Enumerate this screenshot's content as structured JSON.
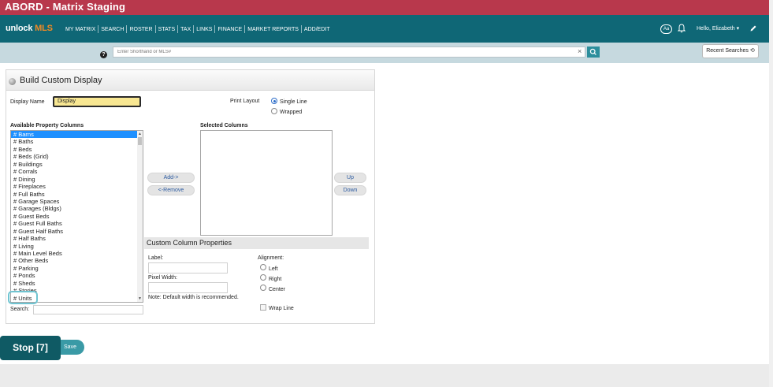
{
  "window": {
    "title": "ABORD - Matrix Staging"
  },
  "nav": {
    "logo_main": "unlock",
    "logo_accent": "MLS",
    "items": [
      "MY MATRIX",
      "SEARCH",
      "ROSTER",
      "STATS",
      "TAX",
      "LINKS",
      "FINANCE",
      "MARKET REPORTS",
      "ADD/EDIT"
    ],
    "aa_label": "Aa",
    "greeting": "Hello, Elizabeth ▾"
  },
  "search": {
    "help_label": "?",
    "placeholder": "Enter Shorthand or MLS#",
    "clear": "×",
    "recent_label": "Recent Searches ⟲"
  },
  "panel": {
    "title": "Build Custom Display",
    "display_name_label": "Display Name",
    "display_name_value": "Display",
    "print_layout_label": "Print Layout",
    "print_options": [
      "Single Line",
      "Wrapped"
    ],
    "available_label": "Available Property Columns",
    "selected_label": "Selected Columns",
    "available_columns": [
      "# Barns",
      "# Baths",
      "# Beds",
      "# Beds (Grid)",
      "# Buildings",
      "# Corrals",
      "# Dining",
      "# Fireplaces",
      "# Full Baths",
      "# Garage Spaces",
      "# Garages (Bldgs)",
      "# Guest Beds",
      "# Guest Full Baths",
      "# Guest Half Baths",
      "# Half Baths",
      "# Living",
      "# Main Level Beds",
      "# Other Beds",
      "# Parking",
      "# Ponds",
      "# Sheds",
      "# Stories",
      "# Units"
    ],
    "search_label": "Search:",
    "add_label": "Add->",
    "remove_label": "<-Remove",
    "up_label": "Up",
    "down_label": "Down"
  },
  "ccp": {
    "title": "Custom Column Properties",
    "label_label": "Label:",
    "pixel_width_label": "Pixel Width:",
    "note": "Note: Default width is recommended.",
    "alignment_label": "Alignment:",
    "alignments": [
      "Left",
      "Right",
      "Center"
    ],
    "wrap_label": "Wrap Line"
  },
  "actions": {
    "stop_label": "Stop [7]",
    "save_label": "Save"
  },
  "colors": {
    "title_bar": "#b8384c",
    "nav_bar": "#0f6776",
    "accent": "#f08a24",
    "selection": "#1e90ff",
    "display_input_bg": "#f8e792"
  }
}
